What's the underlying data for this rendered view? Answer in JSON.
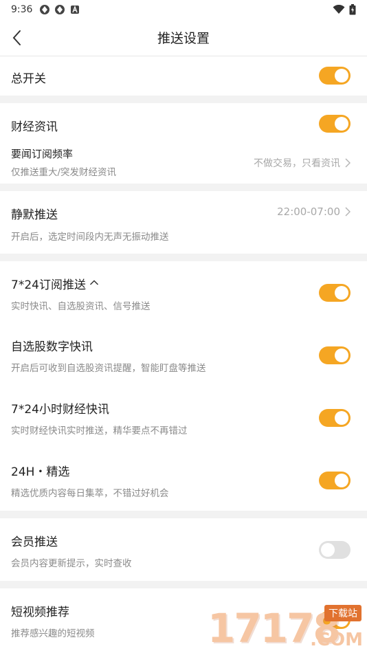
{
  "status_bar": {
    "time": "9:36"
  },
  "nav": {
    "title": "推送设置"
  },
  "master": {
    "title": "总开关",
    "on": true
  },
  "finance": {
    "title": "财经资讯",
    "on": true,
    "freq_title": "要闻订阅频率",
    "freq_sub": "仅推送重大/突发财经资讯",
    "freq_value": "不做交易，只看资讯"
  },
  "silent": {
    "title": "静默推送",
    "value": "22:00-07:00",
    "sub": "开启后，选定时间段内无声无振动推送"
  },
  "subscribe": {
    "title": "7*24订阅推送",
    "sub": "实时快讯、自选股资讯、信号推送",
    "on": true
  },
  "stock_flash": {
    "title": "自选股数字快讯",
    "sub": "开启后可收到自选股资讯提醒，智能盯盘等推送",
    "on": true
  },
  "flash_724": {
    "title": "7*24小时财经快讯",
    "sub": "实时财经快讯实时推送，精华要点不再错过",
    "on": true
  },
  "selected_24h": {
    "title": "24H・精选",
    "sub": "精选优质内容每日集萃，不错过好机会",
    "on": true
  },
  "member": {
    "title": "会员推送",
    "sub": "会员内容更新提示，实时查收",
    "on": false
  },
  "short_video": {
    "title": "短视频推荐",
    "sub": "推荐感兴趣的短视频",
    "on": true
  },
  "watermark": {
    "big": "17178",
    "small": "下载站",
    "com": ".COM"
  },
  "colors": {
    "accent": "#f5a623",
    "toggle_off": "#e0e0e0"
  }
}
